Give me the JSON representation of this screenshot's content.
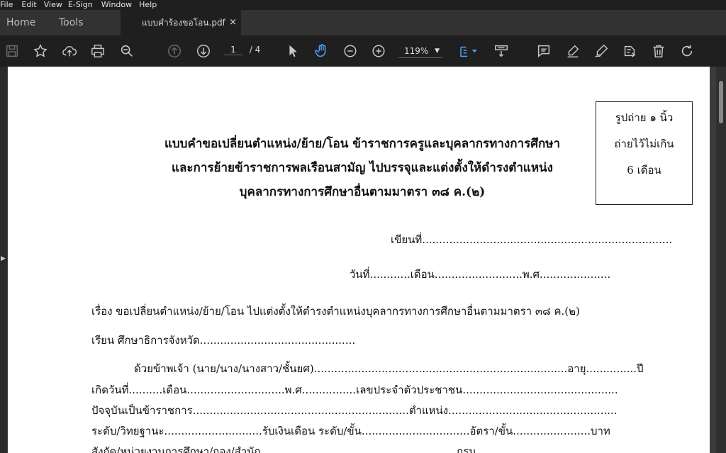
{
  "menu": [
    "File",
    "Edit",
    "View",
    "E-Sign",
    "Window",
    "Help"
  ],
  "tabs": {
    "home": "Home",
    "tools": "Tools",
    "document": "แบบคำร้องขอโอน.pdf",
    "close": "×"
  },
  "toolbar": {
    "page_current": "1",
    "page_total": "/ 4",
    "zoom": "119%",
    "zoom_caret": "▼"
  },
  "document": {
    "photo_box": [
      "รูปถ่าย ๑ นิ้ว",
      "ถ่ายไว้ไม่เกิน",
      "6 เดือน"
    ],
    "title": [
      "แบบคำขอเปลี่ยนตำแหน่ง/ย้าย/โอน ข้าราชการครูและบุคลากรทางการศึกษา",
      "และการย้ายข้าราชการพลเรือนสามัญ ไปบรรจุและแต่งตั้งให้ดำรงตำแหน่ง",
      "บุคลากรทางการศึกษาอื่นตามมาตรา ๓๘ ค.(๒)"
    ],
    "written_at": "เขียนที่..........................................................................",
    "date_line": "วันที่............เดือน..........................พ.ศ.....................",
    "subject": "เรื่อง  ขอเปลี่ยนตำแหน่ง/ย้าย/โอน ไปแต่งตั้งให้ดำรงตำแหน่งบุคลากรทางการศึกษาอื่นตามมาตรา ๓๘ ค.(๒)",
    "to": "เรียน  ศึกษาธิการจังหวัด..............................................",
    "body": [
      "ด้วยข้าพเจ้า (นาย/นาง/นางสาว/ชั้นยศ)...........................................................................อายุ...............ปี",
      "เกิดวันที่..........เดือน.............................พ.ศ................เลขประจำตัวประชาชน..............................................",
      "ปัจจุบันเป็นข้าราชการ................................................................ตำแหน่ง..................................................",
      "ระดับ/วิทยฐานะ.............................รับเงินเดือน ระดับ/ขั้น................................อัตรา/ขั้น.......................บาท",
      "สังกัด/หน่วยงานการศึกษา/กอง/สำนัก..........................................................กรม"
    ]
  },
  "colors": {
    "accent": "#4ea3ff",
    "icon": "#c8c8c8",
    "toolbar_bg": "#1f1f1f"
  }
}
